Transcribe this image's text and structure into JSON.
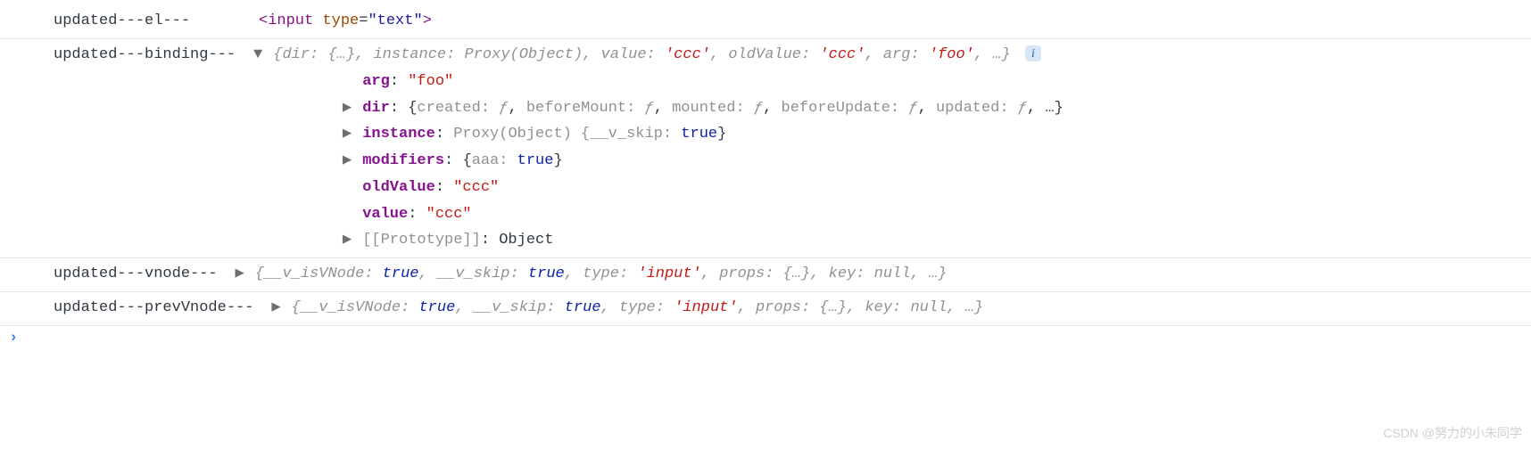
{
  "rows": {
    "el": {
      "label": "updated---el---",
      "tag_open": "<",
      "tag_name": "input",
      "attr_name": "type",
      "eq": "=",
      "attr_val": "\"text\"",
      "tag_close": ">"
    },
    "binding": {
      "label": "updated---binding---",
      "summary": {
        "open": "{",
        "k_dir": "dir: ",
        "v_dir": "{…}",
        "c1": ", ",
        "k_inst": "instance: ",
        "v_inst": "Proxy(Object)",
        "c2": ", ",
        "k_val": "value: ",
        "v_val": "'ccc'",
        "c3": ", ",
        "k_old": "oldValue: ",
        "v_old": "'ccc'",
        "c4": ", ",
        "k_arg": "arg: ",
        "v_arg": "'foo'",
        "c5": ", …",
        "close": "}"
      },
      "children": {
        "arg_k": "arg",
        "arg_v": "\"foo\"",
        "dir_k": "dir",
        "dir_v_open": "{",
        "dir_parts": {
          "k1": "created: ",
          "v1": "ƒ",
          "c1": ", ",
          "k2": "beforeMount: ",
          "v2": "ƒ",
          "c2": ", ",
          "k3": "mounted: ",
          "v3": "ƒ",
          "c3": ", ",
          "k4": "beforeUpdate: ",
          "v4": "ƒ",
          "c4": ", ",
          "k5": "updated: ",
          "v5": "ƒ",
          "c5": ", …"
        },
        "dir_v_close": "}",
        "instance_k": "instance",
        "instance_pre": "Proxy(Object) {",
        "instance_key": "__v_skip: ",
        "instance_val": "true",
        "instance_close": "}",
        "modifiers_k": "modifiers",
        "modifiers_open": "{",
        "modifiers_key": "aaa: ",
        "modifiers_val": "true",
        "modifiers_close": "}",
        "oldValue_k": "oldValue",
        "oldValue_v": "\"ccc\"",
        "value_k": "value",
        "value_v": "\"ccc\"",
        "proto_k": "[[Prototype]]",
        "proto_v": "Object"
      }
    },
    "vnode": {
      "label": "updated---vnode---",
      "summary": {
        "open": "{",
        "k1": "__v_isVNode: ",
        "v1": "true",
        "c1": ", ",
        "k2": "__v_skip: ",
        "v2": "true",
        "c2": ", ",
        "k3": "type: ",
        "v3": "'input'",
        "c3": ", ",
        "k4": "props: ",
        "v4": "{…}",
        "c4": ", ",
        "k5": "key: ",
        "v5": "null",
        "c5": ", …",
        "close": "}"
      }
    },
    "prevVnode": {
      "label": "updated---prevVnode---",
      "summary": {
        "open": "{",
        "k1": "__v_isVNode: ",
        "v1": "true",
        "c1": ", ",
        "k2": "__v_skip: ",
        "v2": "true",
        "c2": ", ",
        "k3": "type: ",
        "v3": "'input'",
        "c3": ", ",
        "k4": "props: ",
        "v4": "{…}",
        "c4": ", ",
        "k5": "key: ",
        "v5": "null",
        "c5": ", …",
        "close": "}"
      }
    }
  },
  "prompt": "›",
  "watermark": "CSDN @努力的小朱同学"
}
